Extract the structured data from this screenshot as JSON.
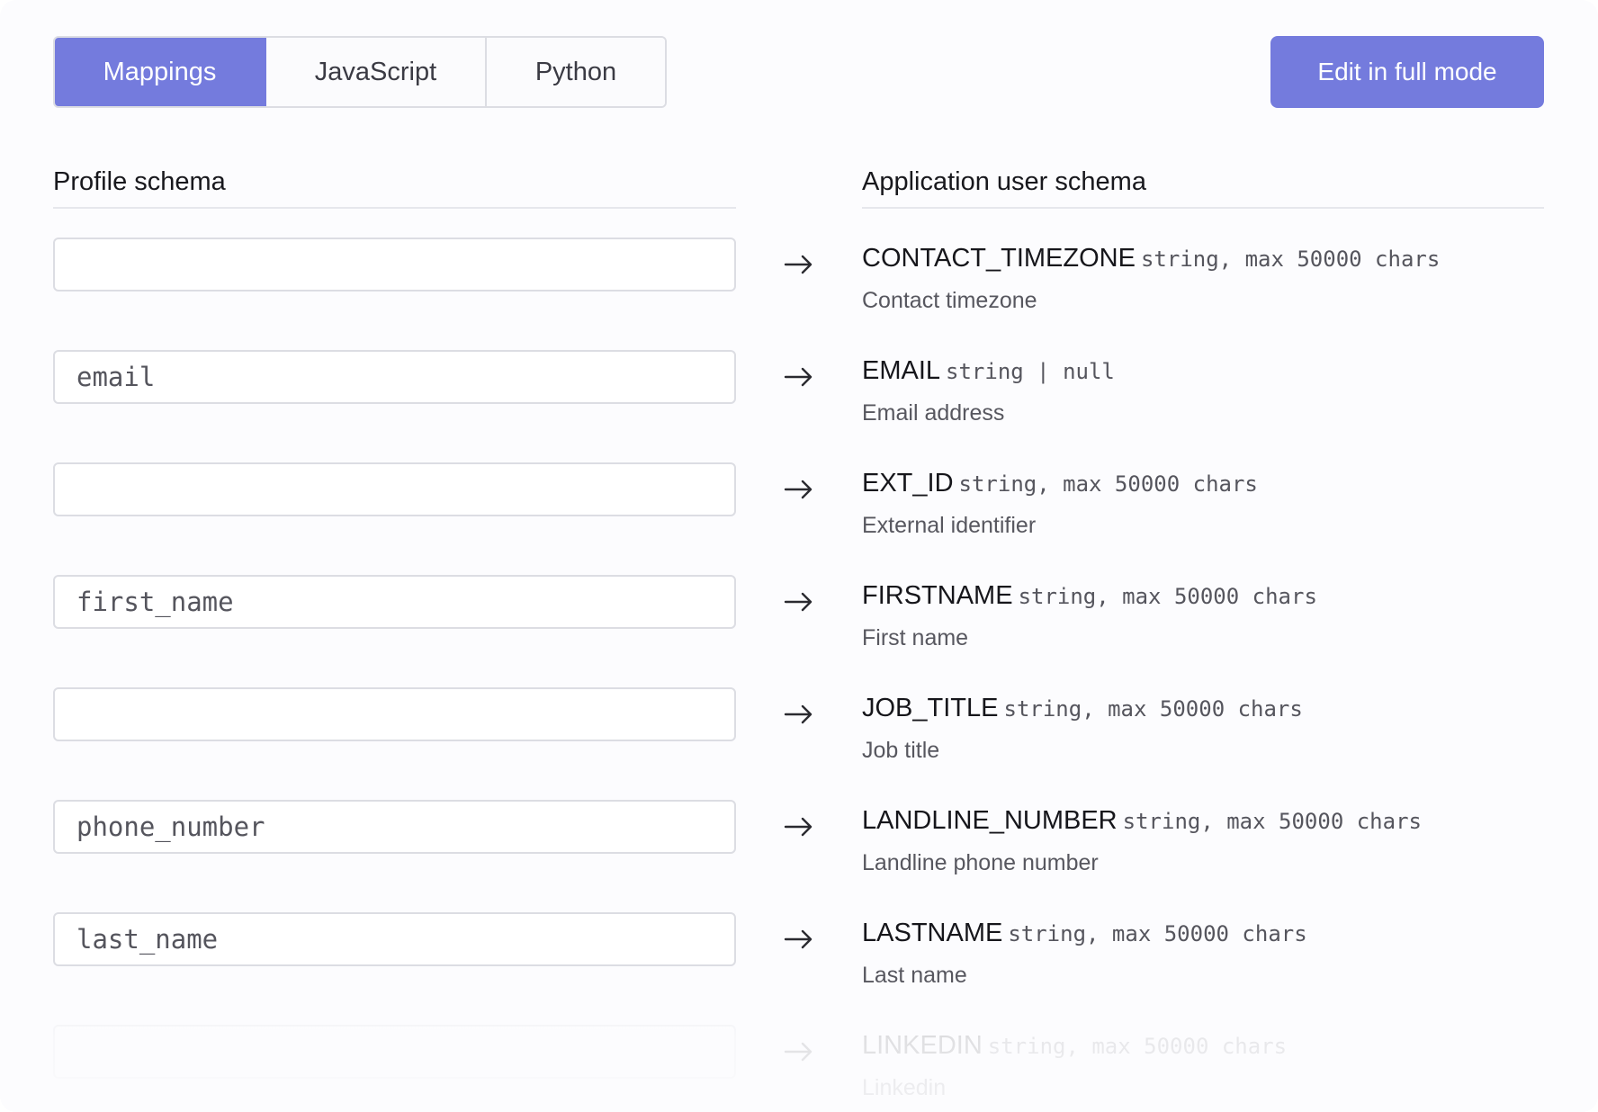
{
  "tabs": [
    {
      "label": "Mappings",
      "active": true
    },
    {
      "label": "JavaScript",
      "active": false
    },
    {
      "label": "Python",
      "active": false
    }
  ],
  "edit_button": {
    "label": "Edit in full mode"
  },
  "columns": {
    "left": "Profile schema",
    "right": "Application user schema"
  },
  "rows": [
    {
      "input": "",
      "name": "CONTACT_TIMEZONE",
      "type": "string, max 50000 chars",
      "description": "Contact timezone"
    },
    {
      "input": "email",
      "name": "EMAIL",
      "type": "string | null",
      "description": "Email address"
    },
    {
      "input": "",
      "name": "EXT_ID",
      "type": "string, max 50000 chars",
      "description": "External identifier"
    },
    {
      "input": "first_name",
      "name": "FIRSTNAME",
      "type": "string, max 50000 chars",
      "description": "First name"
    },
    {
      "input": "",
      "name": "JOB_TITLE",
      "type": "string, max 50000 chars",
      "description": "Job title"
    },
    {
      "input": "phone_number",
      "name": "LANDLINE_NUMBER",
      "type": "string, max 50000 chars",
      "description": "Landline phone number"
    },
    {
      "input": "last_name",
      "name": "LASTNAME",
      "type": "string, max 50000 chars",
      "description": "Last name"
    },
    {
      "input": "",
      "name": "LINKEDIN",
      "type": "string, max 50000 chars",
      "description": "Linkedin"
    }
  ],
  "icons": {
    "arrow": "arrow-right-icon"
  },
  "colors": {
    "accent": "#747bdd",
    "border": "#dcdde3"
  }
}
